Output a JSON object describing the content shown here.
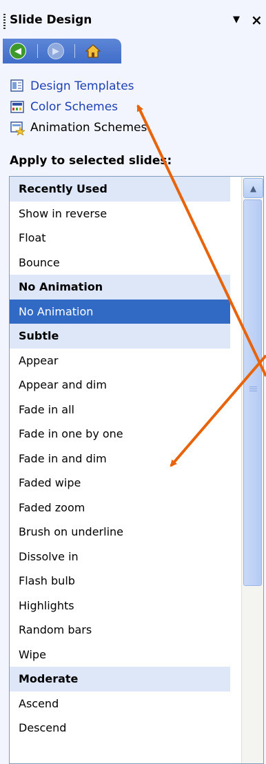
{
  "panel": {
    "title": "Slide Design",
    "menu_arrow": "▼",
    "close": "×"
  },
  "nav": {
    "back_icon": "back-arrow-icon",
    "forward_icon": "forward-arrow-icon",
    "home_icon": "home-icon"
  },
  "links": [
    {
      "label": "Design Templates",
      "icon": "design-templates-icon"
    },
    {
      "label": "Color Schemes",
      "icon": "color-schemes-icon"
    },
    {
      "label": "Animation Schemes",
      "icon": "animation-schemes-icon"
    }
  ],
  "apply_label": "Apply to selected slides:",
  "list": [
    {
      "label": "Recently Used",
      "kind": "header"
    },
    {
      "label": "Show in reverse",
      "kind": "item"
    },
    {
      "label": "Float",
      "kind": "item"
    },
    {
      "label": "Bounce",
      "kind": "item"
    },
    {
      "label": "No Animation",
      "kind": "header"
    },
    {
      "label": "No Animation",
      "kind": "selected"
    },
    {
      "label": "Subtle",
      "kind": "header"
    },
    {
      "label": "Appear",
      "kind": "item"
    },
    {
      "label": "Appear and dim",
      "kind": "item"
    },
    {
      "label": "Fade in all",
      "kind": "item"
    },
    {
      "label": "Fade in one by one",
      "kind": "item"
    },
    {
      "label": "Fade in and dim",
      "kind": "item"
    },
    {
      "label": "Faded wipe",
      "kind": "item"
    },
    {
      "label": "Faded zoom",
      "kind": "item"
    },
    {
      "label": "Brush on underline",
      "kind": "item"
    },
    {
      "label": "Dissolve in",
      "kind": "item"
    },
    {
      "label": "Flash bulb",
      "kind": "item"
    },
    {
      "label": "Highlights",
      "kind": "item"
    },
    {
      "label": "Random bars",
      "kind": "item"
    },
    {
      "label": "Wipe",
      "kind": "item"
    },
    {
      "label": "Moderate",
      "kind": "header"
    },
    {
      "label": "Ascend",
      "kind": "item"
    },
    {
      "label": "Descend",
      "kind": "item"
    }
  ],
  "annotation_color": "#e8640c",
  "selection_color": "#316ac5"
}
